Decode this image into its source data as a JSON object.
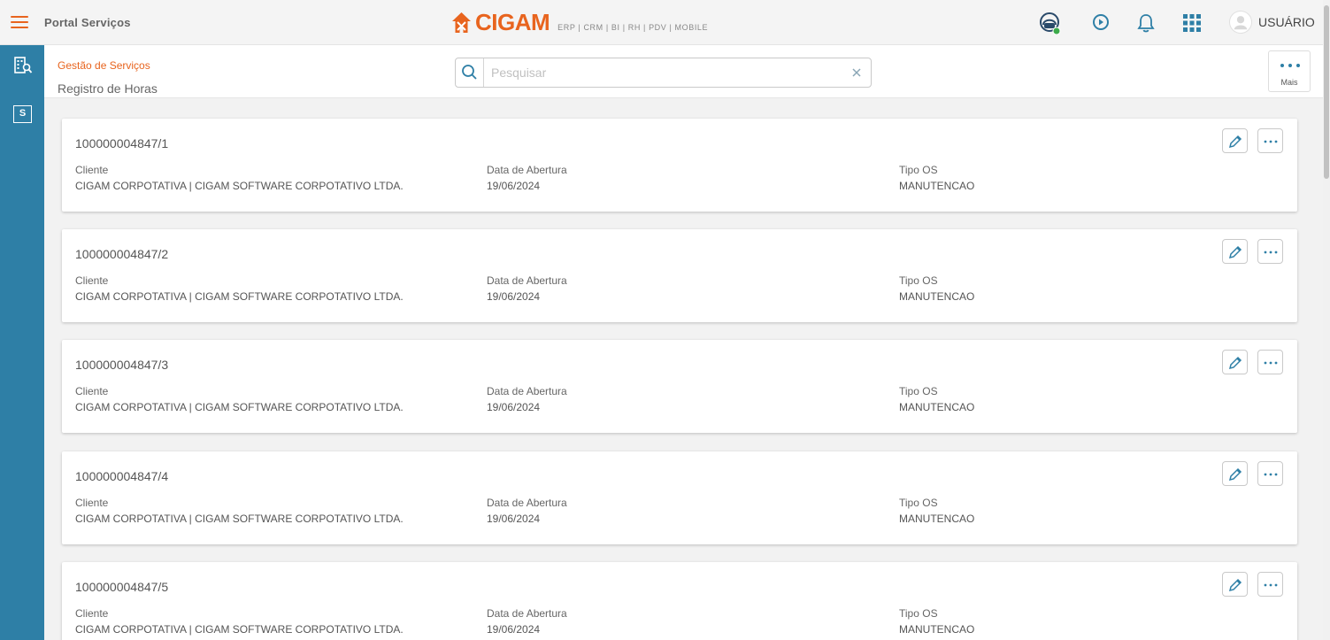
{
  "app": {
    "title": "Portal Serviços",
    "logo_text": "CIGAM",
    "logo_subtitle": "ERP | CRM | BI | RH | PDV | MOBILE",
    "brand_color": "#e8641e",
    "sidebar_color": "#2e7fa6",
    "user_label": "USUÁRIO"
  },
  "topbar_icons": [
    "headset-status-icon",
    "play-circle-icon",
    "bell-icon",
    "apps-grid-icon"
  ],
  "sidebar": {
    "items": [
      {
        "icon": "org-search-icon"
      },
      {
        "icon": "s-box-icon",
        "label": "S"
      }
    ]
  },
  "header": {
    "breadcrumb": "Gestão de Serviços",
    "title": "Registro de Horas",
    "search_placeholder": "Pesquisar",
    "search_value": "",
    "more_label": "Mais"
  },
  "labels": {
    "cliente": "Cliente",
    "data_abertura": "Data de Abertura",
    "tipo_os": "Tipo OS"
  },
  "cards": [
    {
      "id": "100000004847/1",
      "cliente": "CIGAM CORPOTATIVA | CIGAM SOFTWARE CORPOTATIVO LTDA.",
      "data": "19/06/2024",
      "tipo": "MANUTENCAO"
    },
    {
      "id": "100000004847/2",
      "cliente": "CIGAM CORPOTATIVA | CIGAM SOFTWARE CORPOTATIVO LTDA.",
      "data": "19/06/2024",
      "tipo": "MANUTENCAO"
    },
    {
      "id": "100000004847/3",
      "cliente": "CIGAM CORPOTATIVA | CIGAM SOFTWARE CORPOTATIVO LTDA.",
      "data": "19/06/2024",
      "tipo": "MANUTENCAO"
    },
    {
      "id": "100000004847/4",
      "cliente": "CIGAM CORPOTATIVA | CIGAM SOFTWARE CORPOTATIVO LTDA.",
      "data": "19/06/2024",
      "tipo": "MANUTENCAO"
    },
    {
      "id": "100000004847/5",
      "cliente": "CIGAM CORPOTATIVA | CIGAM SOFTWARE CORPOTATIVO LTDA.",
      "data": "19/06/2024",
      "tipo": "MANUTENCAO"
    }
  ]
}
